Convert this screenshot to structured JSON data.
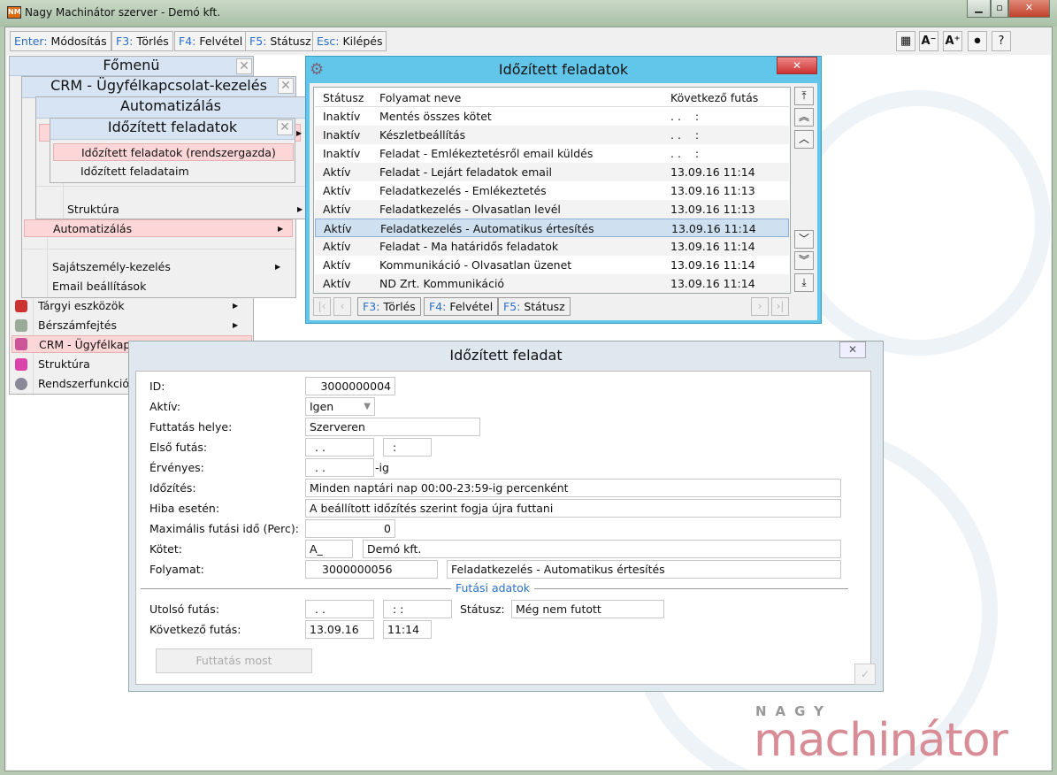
{
  "window": {
    "title": "Nagy Machinátor szerver - Demó kft.",
    "icon": "NM",
    "controls": [
      "minimize",
      "maximize",
      "close"
    ]
  },
  "toolbar": {
    "buttons": [
      {
        "key": "Enter:",
        "label": "Módosítás"
      },
      {
        "key": "F3:",
        "label": "Törlés"
      },
      {
        "key": "F4:",
        "label": "Felvétel"
      },
      {
        "key": "F5:",
        "label": "Státusz"
      },
      {
        "key": "Esc:",
        "label": "Kilépés"
      }
    ],
    "right": [
      {
        "icon": "grid-icon",
        "glyph": "▦"
      },
      {
        "icon": "font-decrease-icon",
        "glyph": "A⁻"
      },
      {
        "icon": "font-increase-icon",
        "glyph": "A⁺"
      },
      {
        "icon": "circle-nav-icon",
        "glyph": "⏺"
      },
      {
        "icon": "help-icon",
        "glyph": "?"
      }
    ]
  },
  "menus": {
    "main": {
      "title": "Főmenü",
      "items": [
        {
          "label": "Tárgyi eszközök",
          "arrow": true
        },
        {
          "label": "Bérszámfejtés",
          "arrow": true
        },
        {
          "label": "CRM - Ügyfélkap"
        },
        {
          "label": "Struktúra"
        },
        {
          "label": "Rendszerfunkciók"
        }
      ]
    },
    "crm": {
      "title": "CRM - Ügyfélkapcsolat-kezelés",
      "items": [
        {
          "label": "Automatizálás"
        },
        {
          "label": "Sajátszemély-kezelés"
        },
        {
          "label": "Email beállítások"
        }
      ]
    },
    "auto": {
      "title": "Automatizálás",
      "items": [
        {
          "label": "Struktúra"
        }
      ]
    },
    "timed": {
      "title": "Időzített feladatok",
      "items": [
        {
          "label": "Időzített feladatok (rendszergazda)"
        },
        {
          "label": "Időzített feladataim"
        }
      ]
    }
  },
  "tasks": {
    "title": "Időzített feladatok",
    "columns": [
      "Státusz",
      "Folyamat neve",
      "Következő futás"
    ],
    "rows": [
      [
        "Inaktív",
        "Mentés összes kötet",
        ". .    :"
      ],
      [
        "Inaktív",
        "Készletbeállítás",
        ". .    :"
      ],
      [
        "Inaktív",
        "Feladat - Emlékeztetésről email küldés",
        ". .    :"
      ],
      [
        "Aktív",
        "Feladat - Lejárt feladatok email",
        "13.09.16 11:14"
      ],
      [
        "Aktív",
        "Feladatkezelés - Emlékeztetés",
        "13.09.16 11:13"
      ],
      [
        "Aktív",
        "Feladatkezelés - Olvasatlan levél",
        "13.09.16 11:13"
      ],
      [
        "Aktív",
        "Feladatkezelés - Automatikus értesítés",
        "13.09.16 11:14"
      ],
      [
        "Aktív",
        "Feladat - Ma határidős feladatok",
        "13.09.16 11:14"
      ],
      [
        "Aktív",
        "Kommunikáció - Olvasatlan üzenet",
        "13.09.16 11:14"
      ],
      [
        "Aktív",
        "ND Zrt. Kommunikáció",
        "13.09.16 11:14"
      ]
    ],
    "selected_row": 6,
    "buttons": [
      {
        "key": "F3:",
        "label": "Törlés"
      },
      {
        "key": "F4:",
        "label": "Felvétel"
      },
      {
        "key": "F5:",
        "label": "Státusz"
      }
    ]
  },
  "dialog": {
    "title": "Időzített feladat",
    "fields": {
      "id_label": "ID:",
      "id": "3000000004",
      "aktiv_label": "Aktív:",
      "aktiv": "Igen",
      "hely_label": "Futtatás helye:",
      "hely": "Szerveren",
      "elso_label": "Első futás:",
      "elso_date": ". .",
      "elso_time": ":",
      "ervenyes_label": "Érvényes:",
      "ervenyes": ". .",
      "ig": "-ig",
      "idozites_label": "Időzítés:",
      "idozites": "Minden  naptári nap  00:00-23:59-ig percenként",
      "hiba_label": "Hiba esetén:",
      "hiba": "A beállított időzítés szerint fogja újra futtani",
      "max_label": "Maximális futási idő (Perc):",
      "max": "0",
      "kotet_label": "Kötet:",
      "kotet_code": "A_",
      "kotet_name": "Demó kft.",
      "folyamat_label": "Folyamat:",
      "folyamat_id": "3000000056",
      "folyamat_name": "Feladatkezelés - Automatikus értesítés"
    },
    "section": "Futási adatok",
    "run": {
      "utolso_label": "Utolsó futás:",
      "utolso_date": ". .",
      "utolso_time": ": :",
      "status_label": "Státusz:",
      "status": "Még nem futott",
      "kov_label": "Következő futás:",
      "kov_date": "13.09.16",
      "kov_time": "11:14"
    },
    "run_now": "Futtatás most"
  },
  "logo": {
    "top": "NAGY",
    "main": "machinátor"
  }
}
